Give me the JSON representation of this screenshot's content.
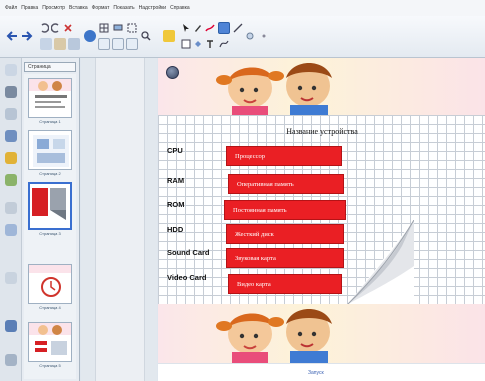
{
  "menu": {
    "items": [
      "Файл",
      "Правка",
      "Просмотр",
      "Вставка",
      "Формат",
      "Показать",
      "Надстройки",
      "Справка"
    ]
  },
  "toolbar": {
    "buttons": [
      "back-icon",
      "forward-icon",
      "undo-icon",
      "redo-icon",
      "delete-icon",
      "screen-shade-icon",
      "table-icon",
      "display-icon",
      "screen-capture-icon",
      "select-icon",
      "pen-icon",
      "creative-pen-icon",
      "eraser-icon",
      "line-icon",
      "shapes-icon",
      "fill-icon",
      "text-icon",
      "properties-icon"
    ]
  },
  "sidebar": {
    "header": "Страница",
    "thumbnails": [
      {
        "caption": "Страница 1"
      },
      {
        "caption": "Страница 2"
      },
      {
        "caption": "Страница 3"
      },
      {
        "caption": "Страница 4"
      },
      {
        "caption": "Страница 5"
      }
    ]
  },
  "slide": {
    "title": "Название устройства",
    "terms": [
      "CPU",
      "RAM",
      "ROM",
      "HDD",
      "Sound Card",
      "Video Card"
    ],
    "answers": [
      "Процессор",
      "Оперативная память",
      "Постоянная память",
      "Жесткий диск",
      "Звуковая карта",
      "Видео карта"
    ]
  },
  "footer": {
    "link": "Запуск"
  },
  "colors": {
    "answer_bg": "#ea1f24",
    "grid_line": "#c7cdd5",
    "banner_pink": "#fbe6ea",
    "accent": "#3a6fd0"
  }
}
